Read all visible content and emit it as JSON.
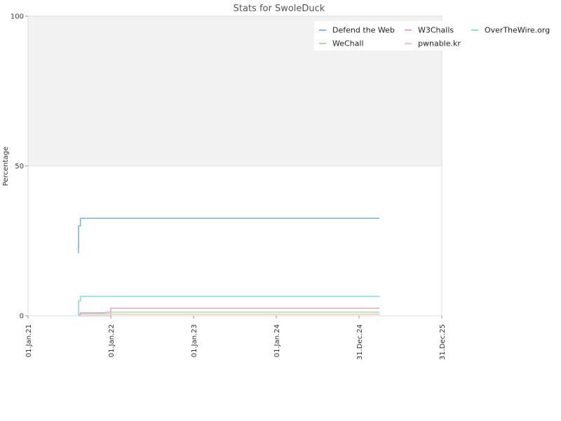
{
  "chart_data": {
    "type": "line",
    "title": "Stats for SwoleDuck",
    "xlabel": "",
    "ylabel": "Percentage",
    "ylim": [
      0,
      100
    ],
    "xlim": [
      "2021-01-01",
      "2025-12-31"
    ],
    "y_ticks": [
      {
        "value": 0,
        "label": "0"
      },
      {
        "value": 50,
        "label": "50"
      },
      {
        "value": 100,
        "label": "100"
      }
    ],
    "x_ticks": [
      {
        "date": "2021-01-01",
        "label": "01.Jan.21"
      },
      {
        "date": "2022-01-01",
        "label": "01.Jan.22"
      },
      {
        "date": "2023-01-01",
        "label": "01.Jan.23"
      },
      {
        "date": "2024-01-01",
        "label": "01.Jan.24"
      },
      {
        "date": "2024-12-31",
        "label": "31.Dec.24"
      },
      {
        "date": "2025-12-31",
        "label": "31.Dec.25"
      }
    ],
    "shaded_band": {
      "from": 50,
      "to": 100,
      "color": "#f2f2f2"
    },
    "grid": "horizontal at 50",
    "legend_position": "top-right",
    "series": [
      {
        "name": "Defend the Web",
        "color": "#7eb6e6",
        "points": [
          {
            "x": "2021-08-10",
            "y": 21
          },
          {
            "x": "2021-08-11",
            "y": 23
          },
          {
            "x": "2021-08-12",
            "y": 30
          },
          {
            "x": "2021-08-20",
            "y": 32.5
          },
          {
            "x": "2025-03-31",
            "y": 32.5
          }
        ]
      },
      {
        "name": "WeChall",
        "color": "#a8e0a0",
        "points": [
          {
            "x": "2021-08-12",
            "y": 0.2
          },
          {
            "x": "2021-08-20",
            "y": 0.6
          },
          {
            "x": "2021-12-10",
            "y": 0.6
          },
          {
            "x": "2022-01-01",
            "y": 1.2
          },
          {
            "x": "2025-03-31",
            "y": 1.2
          }
        ]
      },
      {
        "name": "W3Challs",
        "color": "#e6a8d8",
        "points": [
          {
            "x": "2021-08-12",
            "y": 0.5
          },
          {
            "x": "2021-08-20",
            "y": 1.0
          },
          {
            "x": "2021-12-10",
            "y": 1.2
          },
          {
            "x": "2022-01-01",
            "y": 2.5
          },
          {
            "x": "2025-03-31",
            "y": 2.5
          }
        ]
      },
      {
        "name": "pwnable.kr",
        "color": "#f4c2c2",
        "points": [
          {
            "x": "2021-08-12",
            "y": 0
          },
          {
            "x": "2021-12-20",
            "y": 0
          },
          {
            "x": "2022-01-01",
            "y": 0.5
          },
          {
            "x": "2025-03-31",
            "y": 0.5
          }
        ]
      },
      {
        "name": "OverTheWire.org",
        "color": "#8ae0d4",
        "points": [
          {
            "x": "2021-08-11",
            "y": 0
          },
          {
            "x": "2021-08-12",
            "y": 5
          },
          {
            "x": "2021-08-20",
            "y": 6.5
          },
          {
            "x": "2025-03-31",
            "y": 6.5
          }
        ]
      }
    ]
  }
}
